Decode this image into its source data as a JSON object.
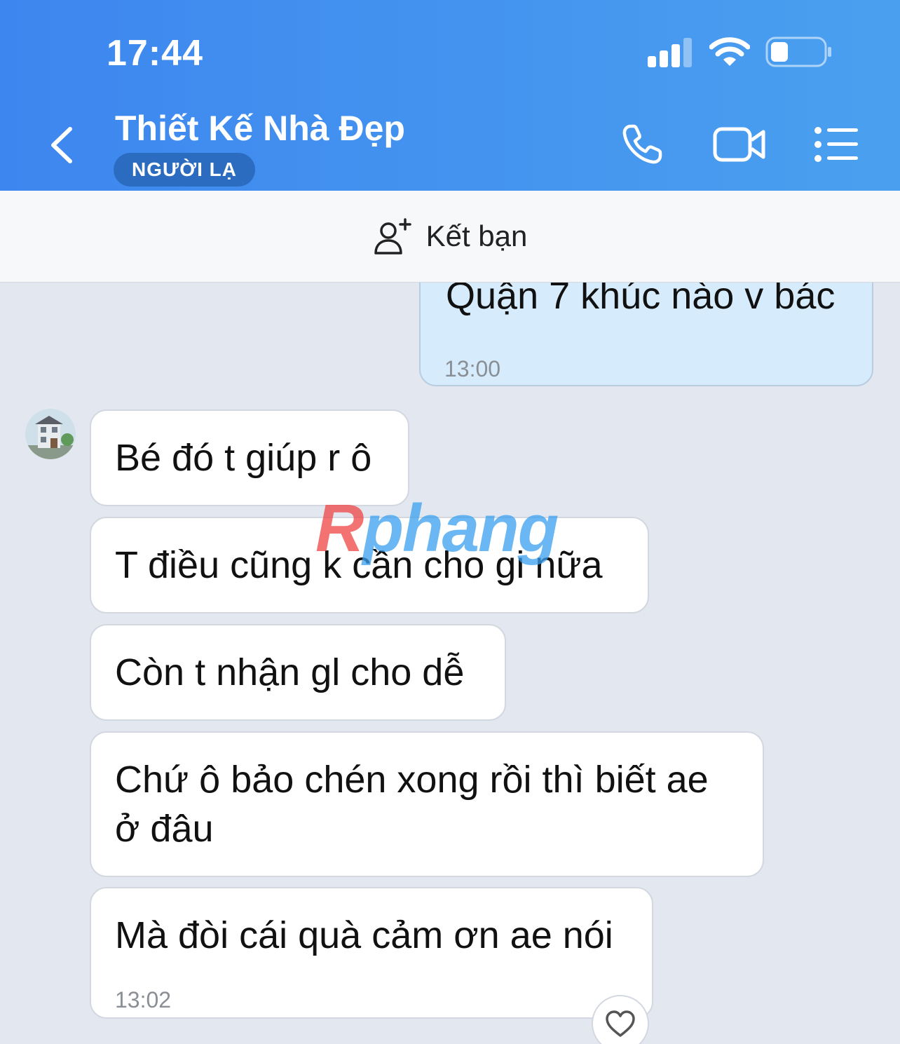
{
  "status_bar": {
    "time": "17:44"
  },
  "header": {
    "title": "Thiết Kế Nhà Đẹp",
    "badge": "NGƯỜI LẠ",
    "icons": [
      "chevron-left-icon",
      "phone-icon",
      "video-camera-icon",
      "list-menu-icon"
    ]
  },
  "friend_bar": {
    "label": "Kết bạn",
    "icon": "add-user-icon"
  },
  "messages": [
    {
      "direction": "out",
      "text": "Quận 7 khúc nào v bác",
      "time": "13:00"
    },
    {
      "direction": "in",
      "text": "Bé đó t giúp r ô"
    },
    {
      "direction": "in",
      "text": "T điều cũng k cần cho gi nữa"
    },
    {
      "direction": "in",
      "text": "Còn t nhận gl cho dễ"
    },
    {
      "direction": "in",
      "text": "Chứ ô bảo chén xong rồi thì biết ae ở đâu"
    },
    {
      "direction": "in",
      "text": "Mà đòi cái quà cảm ơn ae nói",
      "time": "13:02"
    }
  ],
  "watermark": {
    "part1": "R",
    "part2": "phang"
  },
  "colors": {
    "header": "#3d86ef",
    "outgoing_bubble": "#d6ecfd",
    "badge": "#2c6cc0"
  }
}
